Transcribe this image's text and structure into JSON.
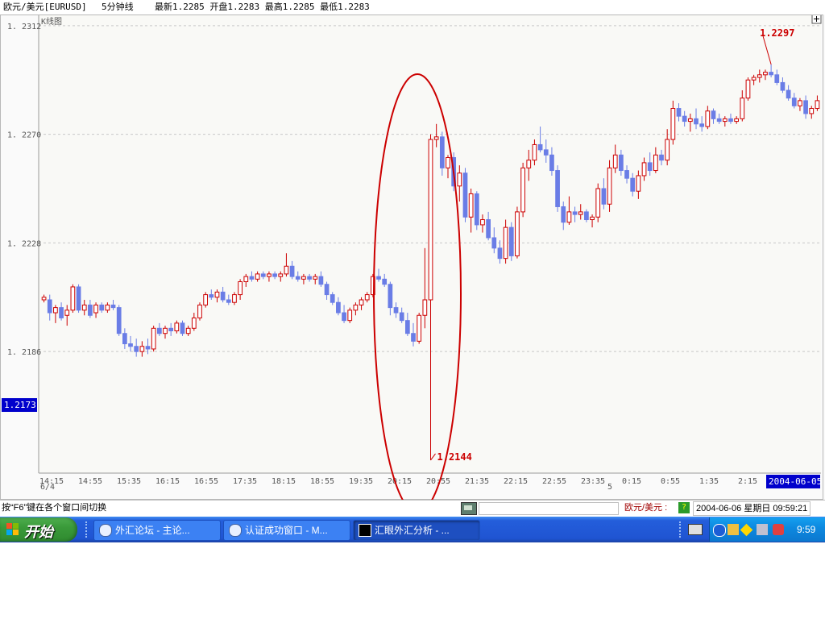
{
  "infobar": {
    "symbol": "欧元/美元[EURUSD]",
    "period": "5分钟线",
    "quote": "最新1.2285 开盘1.2283 最高1.2285 最低1.2283"
  },
  "chart": {
    "title": "K线图",
    "expand_icon": "plus-box-icon",
    "current_price_label": "1.2173",
    "x_footer_left": "6/4",
    "x_footer_mid": "5",
    "date_badge": "2004-06-05",
    "annotations": {
      "high": "1.2297",
      "low": "1.2144"
    },
    "colors": {
      "up": "#cc0000",
      "down": "#6a7de6",
      "annotation": "#cc0000",
      "grid": "#c8c8c8",
      "price_tag_bg": "#0000cc"
    }
  },
  "chart_data": {
    "type": "candlestick",
    "title": "K线图",
    "y_ticks": [
      1.2312,
      1.227,
      1.2228,
      1.2186
    ],
    "ylim": [
      1.2139,
      1.2316
    ],
    "x_ticks": [
      "14:15",
      "14:55",
      "15:35",
      "16:15",
      "16:55",
      "17:35",
      "18:15",
      "18:55",
      "19:35",
      "20:15",
      "20:55",
      "21:35",
      "22:15",
      "22:55",
      "23:35",
      "0:15",
      "0:55",
      "1:35",
      "2:15"
    ],
    "grid": true,
    "annotations": [
      {
        "text": "1.2297",
        "value": 1.2297
      },
      {
        "text": "1.2144",
        "value": 1.2144
      }
    ],
    "candles": [
      [
        1.2206,
        1.2208,
        1.2205,
        1.2207
      ],
      [
        1.2206,
        1.2208,
        1.2198,
        1.2201
      ],
      [
        1.2201,
        1.2204,
        1.2197,
        1.2203
      ],
      [
        1.2203,
        1.2205,
        1.2198,
        1.2199
      ],
      [
        1.22,
        1.2204,
        1.2196,
        1.2202
      ],
      [
        1.2202,
        1.2212,
        1.2201,
        1.2211
      ],
      [
        1.2211,
        1.2212,
        1.2201,
        1.2202
      ],
      [
        1.2202,
        1.2206,
        1.22,
        1.2204
      ],
      [
        1.2204,
        1.2206,
        1.2199,
        1.22
      ],
      [
        1.2201,
        1.2205,
        1.2199,
        1.2204
      ],
      [
        1.2204,
        1.2205,
        1.2201,
        1.2202
      ],
      [
        1.2202,
        1.2205,
        1.2201,
        1.2204
      ],
      [
        1.2204,
        1.2206,
        1.2202,
        1.2203
      ],
      [
        1.2203,
        1.2204,
        1.2192,
        1.2193
      ],
      [
        1.2193,
        1.2195,
        1.2187,
        1.2189
      ],
      [
        1.2189,
        1.2192,
        1.2186,
        1.2188
      ],
      [
        1.2188,
        1.2191,
        1.2184,
        1.2186
      ],
      [
        1.2186,
        1.219,
        1.2184,
        1.2188
      ],
      [
        1.2188,
        1.2191,
        1.2185,
        1.2187
      ],
      [
        1.2187,
        1.2196,
        1.2186,
        1.2195
      ],
      [
        1.2195,
        1.2197,
        1.2192,
        1.2193
      ],
      [
        1.2193,
        1.2196,
        1.2191,
        1.2195
      ],
      [
        1.2195,
        1.2197,
        1.2192,
        1.2194
      ],
      [
        1.2194,
        1.2198,
        1.2193,
        1.2197
      ],
      [
        1.2197,
        1.2198,
        1.2192,
        1.2193
      ],
      [
        1.2193,
        1.2196,
        1.2192,
        1.2195
      ],
      [
        1.2195,
        1.2201,
        1.2194,
        1.2199
      ],
      [
        1.2199,
        1.2205,
        1.2198,
        1.2204
      ],
      [
        1.2204,
        1.2209,
        1.2203,
        1.2208
      ],
      [
        1.2208,
        1.221,
        1.2206,
        1.2207
      ],
      [
        1.2207,
        1.221,
        1.2205,
        1.2209
      ],
      [
        1.2209,
        1.2211,
        1.2205,
        1.2206
      ],
      [
        1.2206,
        1.2208,
        1.2204,
        1.2205
      ],
      [
        1.2205,
        1.2209,
        1.2204,
        1.2208
      ],
      [
        1.2208,
        1.2214,
        1.2206,
        1.2213
      ],
      [
        1.2213,
        1.2216,
        1.2211,
        1.2215
      ],
      [
        1.2215,
        1.2217,
        1.2213,
        1.2214
      ],
      [
        1.2214,
        1.2217,
        1.2213,
        1.2216
      ],
      [
        1.2216,
        1.2217,
        1.2214,
        1.2215
      ],
      [
        1.2215,
        1.2217,
        1.2213,
        1.2216
      ],
      [
        1.2216,
        1.2217,
        1.2214,
        1.2215
      ],
      [
        1.2215,
        1.2217,
        1.2213,
        1.2216
      ],
      [
        1.2216,
        1.2224,
        1.2215,
        1.2219
      ],
      [
        1.2219,
        1.2221,
        1.2214,
        1.2215
      ],
      [
        1.2215,
        1.2217,
        1.2213,
        1.2214
      ],
      [
        1.2214,
        1.2216,
        1.2212,
        1.2215
      ],
      [
        1.2215,
        1.2216,
        1.2213,
        1.2214
      ],
      [
        1.2214,
        1.2216,
        1.2212,
        1.2215
      ],
      [
        1.2215,
        1.2217,
        1.2211,
        1.2212
      ],
      [
        1.2212,
        1.2213,
        1.2206,
        1.2208
      ],
      [
        1.2208,
        1.2209,
        1.2204,
        1.2205
      ],
      [
        1.2205,
        1.2207,
        1.22,
        1.2201
      ],
      [
        1.2201,
        1.2204,
        1.2197,
        1.2198
      ],
      [
        1.2198,
        1.2203,
        1.2197,
        1.2202
      ],
      [
        1.2202,
        1.2205,
        1.22,
        1.2204
      ],
      [
        1.2204,
        1.2207,
        1.2202,
        1.2206
      ],
      [
        1.2206,
        1.2209,
        1.2205,
        1.2208
      ],
      [
        1.2208,
        1.2216,
        1.2207,
        1.2215
      ],
      [
        1.2215,
        1.2218,
        1.2213,
        1.2214
      ],
      [
        1.2214,
        1.2216,
        1.2211,
        1.2212
      ],
      [
        1.2212,
        1.2213,
        1.22,
        1.2203
      ],
      [
        1.2203,
        1.2205,
        1.2199,
        1.2201
      ],
      [
        1.2201,
        1.2203,
        1.2197,
        1.2198
      ],
      [
        1.2198,
        1.2201,
        1.2192,
        1.2193
      ],
      [
        1.2193,
        1.2197,
        1.2188,
        1.219
      ],
      [
        1.219,
        1.2201,
        1.2189,
        1.22
      ],
      [
        1.22,
        1.2226,
        1.2195,
        1.2206
      ],
      [
        1.2206,
        1.227,
        1.2144,
        1.2268
      ],
      [
        1.2268,
        1.2274,
        1.2265,
        1.2269
      ],
      [
        1.2269,
        1.2271,
        1.2254,
        1.2257
      ],
      [
        1.2257,
        1.2262,
        1.2253,
        1.2261
      ],
      [
        1.2261,
        1.2263,
        1.2248,
        1.225
      ],
      [
        1.225,
        1.2258,
        1.2244,
        1.2255
      ],
      [
        1.2255,
        1.2257,
        1.2236,
        1.2238
      ],
      [
        1.2238,
        1.2249,
        1.2232,
        1.2247
      ],
      [
        1.2247,
        1.2248,
        1.2233,
        1.2235
      ],
      [
        1.2235,
        1.2239,
        1.2232,
        1.2237
      ],
      [
        1.2237,
        1.224,
        1.2229,
        1.223
      ],
      [
        1.223,
        1.2234,
        1.2224,
        1.2226
      ],
      [
        1.2226,
        1.2229,
        1.222,
        1.2222
      ],
      [
        1.2222,
        1.2237,
        1.222,
        1.2234
      ],
      [
        1.2234,
        1.2236,
        1.2221,
        1.2223
      ],
      [
        1.2223,
        1.2242,
        1.2222,
        1.224
      ],
      [
        1.224,
        1.2259,
        1.2238,
        1.2257
      ],
      [
        1.2257,
        1.2264,
        1.2252,
        1.226
      ],
      [
        1.226,
        1.2268,
        1.2258,
        1.2266
      ],
      [
        1.2266,
        1.2273,
        1.2263,
        1.2264
      ],
      [
        1.2264,
        1.2268,
        1.2259,
        1.2262
      ],
      [
        1.2262,
        1.2265,
        1.2254,
        1.2256
      ],
      [
        1.2256,
        1.2258,
        1.224,
        1.2242
      ],
      [
        1.2242,
        1.2244,
        1.2233,
        1.2236
      ],
      [
        1.2236,
        1.2246,
        1.2235,
        1.224
      ],
      [
        1.224,
        1.2242,
        1.2236,
        1.2239
      ],
      [
        1.2239,
        1.2243,
        1.2237,
        1.224
      ],
      [
        1.224,
        1.2241,
        1.2236,
        1.2237
      ],
      [
        1.2237,
        1.2239,
        1.2234,
        1.2238
      ],
      [
        1.2238,
        1.2251,
        1.2236,
        1.2249
      ],
      [
        1.2249,
        1.2253,
        1.2241,
        1.2243
      ],
      [
        1.2243,
        1.226,
        1.224,
        1.2257
      ],
      [
        1.2257,
        1.2266,
        1.2255,
        1.2262
      ],
      [
        1.2262,
        1.2264,
        1.2254,
        1.2256
      ],
      [
        1.2256,
        1.2258,
        1.2251,
        1.2253
      ],
      [
        1.2253,
        1.2255,
        1.2246,
        1.2248
      ],
      [
        1.2248,
        1.2256,
        1.2245,
        1.2254
      ],
      [
        1.2254,
        1.2261,
        1.2252,
        1.2259
      ],
      [
        1.2259,
        1.2263,
        1.2254,
        1.2256
      ],
      [
        1.2256,
        1.2265,
        1.2255,
        1.2262
      ],
      [
        1.2262,
        1.2264,
        1.2258,
        1.226
      ],
      [
        1.226,
        1.2272,
        1.2258,
        1.2268
      ],
      [
        1.2268,
        1.2283,
        1.2266,
        1.228
      ],
      [
        1.228,
        1.2282,
        1.2275,
        1.2277
      ],
      [
        1.2277,
        1.2279,
        1.2273,
        1.2275
      ],
      [
        1.2275,
        1.2278,
        1.2271,
        1.2276
      ],
      [
        1.2276,
        1.228,
        1.2272,
        1.2274
      ],
      [
        1.2274,
        1.2277,
        1.2271,
        1.2273
      ],
      [
        1.2273,
        1.2281,
        1.2272,
        1.2279
      ],
      [
        1.2279,
        1.228,
        1.2274,
        1.2276
      ],
      [
        1.2276,
        1.2278,
        1.2274,
        1.2275
      ],
      [
        1.2275,
        1.2277,
        1.2273,
        1.2276
      ],
      [
        1.2276,
        1.2278,
        1.2274,
        1.2275
      ],
      [
        1.2275,
        1.2277,
        1.2274,
        1.2276
      ],
      [
        1.2276,
        1.2287,
        1.2275,
        1.2284
      ],
      [
        1.2284,
        1.2292,
        1.2283,
        1.2291
      ],
      [
        1.2291,
        1.2293,
        1.2289,
        1.2292
      ],
      [
        1.2292,
        1.2295,
        1.229,
        1.2293
      ],
      [
        1.2293,
        1.2295,
        1.2291,
        1.2294
      ],
      [
        1.2294,
        1.2297,
        1.2292,
        1.2293
      ],
      [
        1.2293,
        1.2295,
        1.2289,
        1.229
      ],
      [
        1.229,
        1.2292,
        1.2286,
        1.2287
      ],
      [
        1.2287,
        1.2289,
        1.2283,
        1.2284
      ],
      [
        1.2284,
        1.2286,
        1.228,
        1.2281
      ],
      [
        1.2281,
        1.2284,
        1.2279,
        1.2283
      ],
      [
        1.2283,
        1.2285,
        1.2276,
        1.2278
      ],
      [
        1.2278,
        1.2281,
        1.2276,
        1.228
      ],
      [
        1.228,
        1.2285,
        1.2279,
        1.2283
      ]
    ]
  },
  "statusbar": {
    "hint": "按“F6”键在各个窗口间切换",
    "pair": "欧元/美元 :",
    "datetime": "2004-06-06  星期日  09:59:21"
  },
  "taskbar": {
    "start": "开始",
    "buttons": [
      {
        "label": "外汇论坛 - 主论..."
      },
      {
        "label": "认证成功窗口 - M..."
      },
      {
        "label": "汇眼外汇分析 - ..."
      }
    ],
    "clock": "9:59"
  }
}
